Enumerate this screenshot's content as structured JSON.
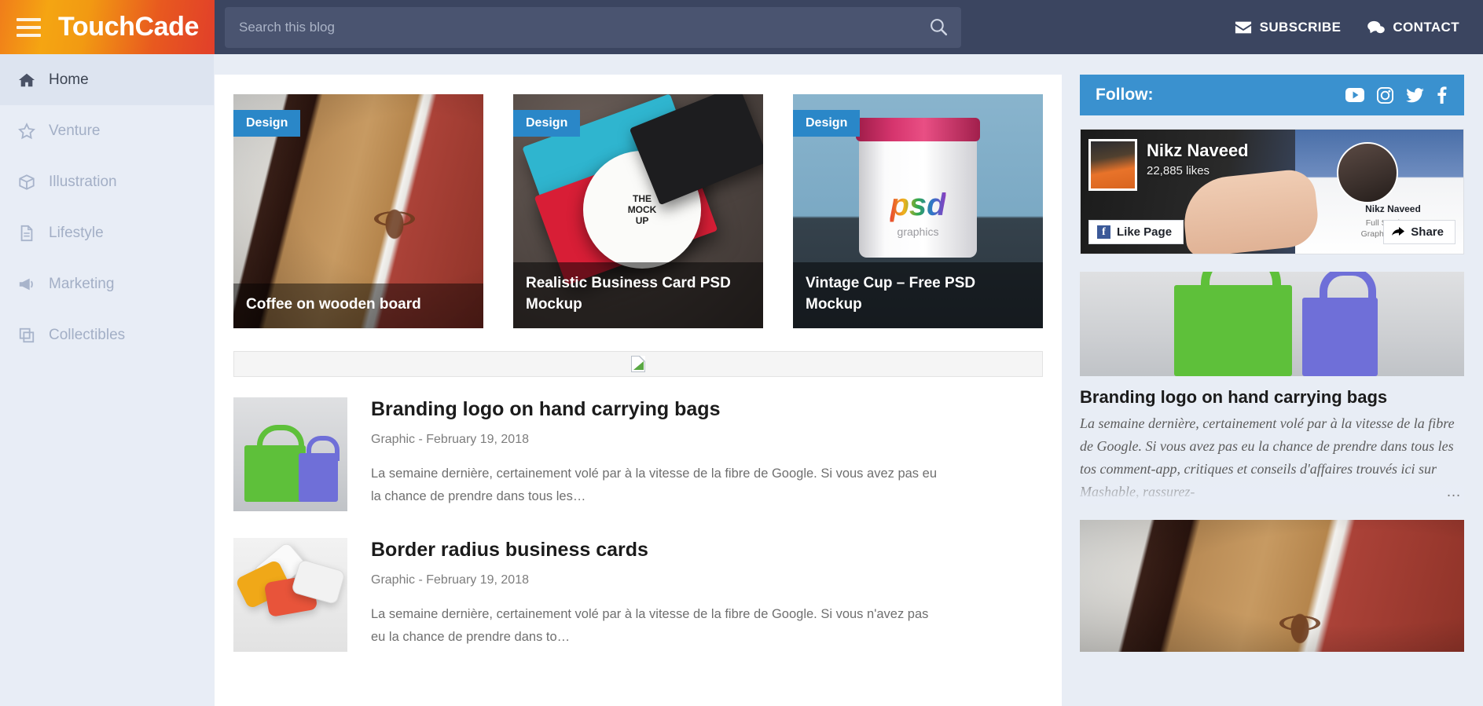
{
  "header": {
    "brand": "TouchCade",
    "menu_icon": "hamburger-icon",
    "search": {
      "placeholder": "Search this blog",
      "value": "",
      "icon": "search-icon"
    },
    "links": [
      {
        "label": "SUBSCRIBE",
        "icon": "envelope-icon"
      },
      {
        "label": "CONTACT",
        "icon": "comments-icon"
      }
    ]
  },
  "sidebar": {
    "items": [
      {
        "label": "Home",
        "icon": "home-icon",
        "active": true
      },
      {
        "label": "Venture",
        "icon": "star-icon",
        "active": false
      },
      {
        "label": "Illustration",
        "icon": "cube-icon",
        "active": false
      },
      {
        "label": "Lifestyle",
        "icon": "document-icon",
        "active": false
      },
      {
        "label": "Marketing",
        "icon": "megaphone-icon",
        "active": false
      },
      {
        "label": "Collectibles",
        "icon": "copy-icon",
        "active": false
      }
    ]
  },
  "featured": [
    {
      "badge": "Design",
      "title": "Coffee on wooden board"
    },
    {
      "badge": "Design",
      "title": "Realistic Business Card PSD Mockup"
    },
    {
      "badge": "Design",
      "title": "Vintage Cup – Free PSD Mockup"
    }
  ],
  "ad_slot": {
    "icon": "broken-image-icon"
  },
  "posts": [
    {
      "title": "Branding logo on hand carrying bags",
      "meta": "Graphic - February 19, 2018",
      "excerpt": "La semaine dernière, certainement volé par à la vitesse de la fibre de Google. Si vous avez pas eu la chance de prendre dans tous les…"
    },
    {
      "title": "Border radius business cards",
      "meta": "Graphic - February 19, 2018",
      "excerpt": "La semaine dernière, certainement volé par à la vitesse de la fibre de Google. Si vous n'avez pas eu la chance de prendre dans to…"
    }
  ],
  "right": {
    "follow": {
      "label": "Follow:",
      "icons": [
        {
          "name": "youtube-icon"
        },
        {
          "name": "instagram-icon"
        },
        {
          "name": "twitter-icon"
        },
        {
          "name": "facebook-icon"
        }
      ]
    },
    "facebook_widget": {
      "page_name": "Nikz Naveed",
      "likes": "22,885 likes",
      "like_button": "Like Page",
      "share_button": "Share",
      "cover_name": "Nikz Naveed",
      "cover_role_line1": "Full Stack W…",
      "cover_role_line2": "Graphic Designer"
    },
    "featured_post": {
      "title": "Branding logo on hand carrying bags",
      "excerpt": "La semaine dernière, certainement volé par à la vitesse de la fibre de Google. Si vous avez pas eu la chance de prendre dans tous les tos comment-app, critiques et conseils d'affaires trouvés ici sur Mashable, rassurez-",
      "ellipsis": "…"
    }
  },
  "colors": {
    "header_bg": "#3b4560",
    "brand_orange": "#f5a512",
    "brand_red": "#e13f2a",
    "badge_blue": "#2a87c8",
    "follow_blue": "#3a91cf",
    "page_bg": "#e8edf6",
    "facebook_blue": "#3b5998"
  }
}
